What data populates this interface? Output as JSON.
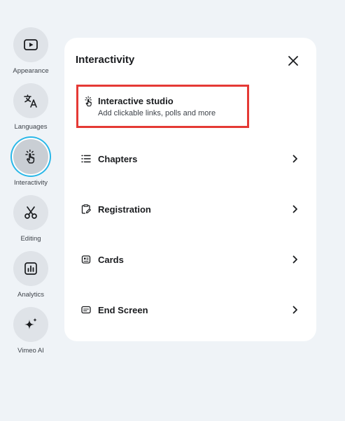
{
  "sidebar": {
    "items": [
      {
        "label": "Appearance",
        "icon": "play-square-icon",
        "active": false
      },
      {
        "label": "Languages",
        "icon": "translate-icon",
        "active": false
      },
      {
        "label": "Interactivity",
        "icon": "pointer-click-icon",
        "active": true
      },
      {
        "label": "Editing",
        "icon": "scissors-icon",
        "active": false
      },
      {
        "label": "Analytics",
        "icon": "analytics-chart-icon",
        "active": false
      },
      {
        "label": "Vimeo AI",
        "icon": "sparkle-icon",
        "active": false
      }
    ]
  },
  "panel": {
    "title": "Interactivity",
    "close_icon": "close-icon",
    "studio": {
      "title": "Interactive studio",
      "subtitle": "Add clickable links, polls and more",
      "icon": "pointer-click-icon",
      "highlight_color": "#e53935"
    },
    "rows": [
      {
        "label": "Chapters",
        "icon": "list-icon"
      },
      {
        "label": "Registration",
        "icon": "clipboard-edit-icon"
      },
      {
        "label": "Cards",
        "icon": "card-icon"
      },
      {
        "label": "End Screen",
        "icon": "end-screen-icon"
      }
    ]
  },
  "colors": {
    "background": "#eff3f7",
    "active_ring": "#29b7e8",
    "panel": "#ffffff"
  }
}
